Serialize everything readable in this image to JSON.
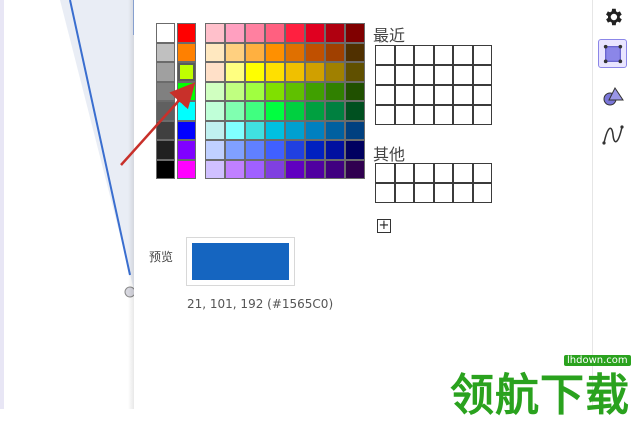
{
  "palette": {
    "basic_grid": [
      [
        "#ffffff",
        "#ff0000"
      ],
      [
        "#c0c0c0",
        "#ff8000"
      ],
      [
        "#a0a0a0",
        "#c0ff00"
      ],
      [
        "#808080",
        "#00ff00"
      ],
      [
        "#606060",
        "#00ffff"
      ],
      [
        "#404040",
        "#0000ff"
      ],
      [
        "#202020",
        "#8000ff"
      ],
      [
        "#000000",
        "#ff00ff"
      ]
    ],
    "basic_selected": [
      2,
      1
    ],
    "full_grid": [
      [
        "#ffc0cb",
        "#ffa0c0",
        "#ff80a0",
        "#ff6080",
        "#ff2040",
        "#e00020",
        "#b00010",
        "#800000"
      ],
      [
        "#ffe8c0",
        "#ffd080",
        "#ffb040",
        "#ff9000",
        "#e07000",
        "#c05000",
        "#a04000",
        "#503000"
      ],
      [
        "#ffe0c8",
        "#ffff80",
        "#ffff00",
        "#ffe000",
        "#f0c000",
        "#d0a000",
        "#a08000",
        "#605000"
      ],
      [
        "#d0ffc0",
        "#c0ff80",
        "#a0ff40",
        "#80e000",
        "#60c000",
        "#40a000",
        "#308000",
        "#205000"
      ],
      [
        "#c0ffd8",
        "#80ffb0",
        "#40ff80",
        "#00ff40",
        "#00d040",
        "#00a040",
        "#008040",
        "#005020"
      ],
      [
        "#c0f0f0",
        "#80ffff",
        "#40e0e0",
        "#00c0e0",
        "#00a0d0",
        "#0080c0",
        "#0060a0",
        "#004080"
      ],
      [
        "#c0d0ff",
        "#80a0ff",
        "#6080ff",
        "#4060ff",
        "#2040e0",
        "#0020c0",
        "#0010a0",
        "#000060"
      ],
      [
        "#d0c0ff",
        "#c080ff",
        "#a060ff",
        "#8040e0",
        "#6000c0",
        "#5000a0",
        "#400080",
        "#300050"
      ]
    ]
  },
  "recent": {
    "label": "最近",
    "rows": 4,
    "cols": 6
  },
  "other": {
    "label": "其他",
    "rows": 2,
    "cols": 6
  },
  "add_button": {
    "label": "+"
  },
  "preview": {
    "label": "预览",
    "color": "#1565C0",
    "rgb_text": "21, 101, 192 (#1565C0)"
  },
  "toolbar": {
    "tools": [
      {
        "name": "settings-gear-icon",
        "active": false
      },
      {
        "name": "polygon-tool-icon",
        "active": true
      },
      {
        "name": "shapes-tool-icon",
        "active": false
      },
      {
        "name": "function-curve-icon",
        "active": false
      }
    ]
  },
  "colors": {
    "annotation_arrow": "#c8302a",
    "construction_line": "#3a6ecf",
    "watermark": "#2aa21e",
    "active_tool_bg": "#e9e5ff"
  },
  "watermark": {
    "text": "领航下载",
    "url": "lhdown.com"
  }
}
